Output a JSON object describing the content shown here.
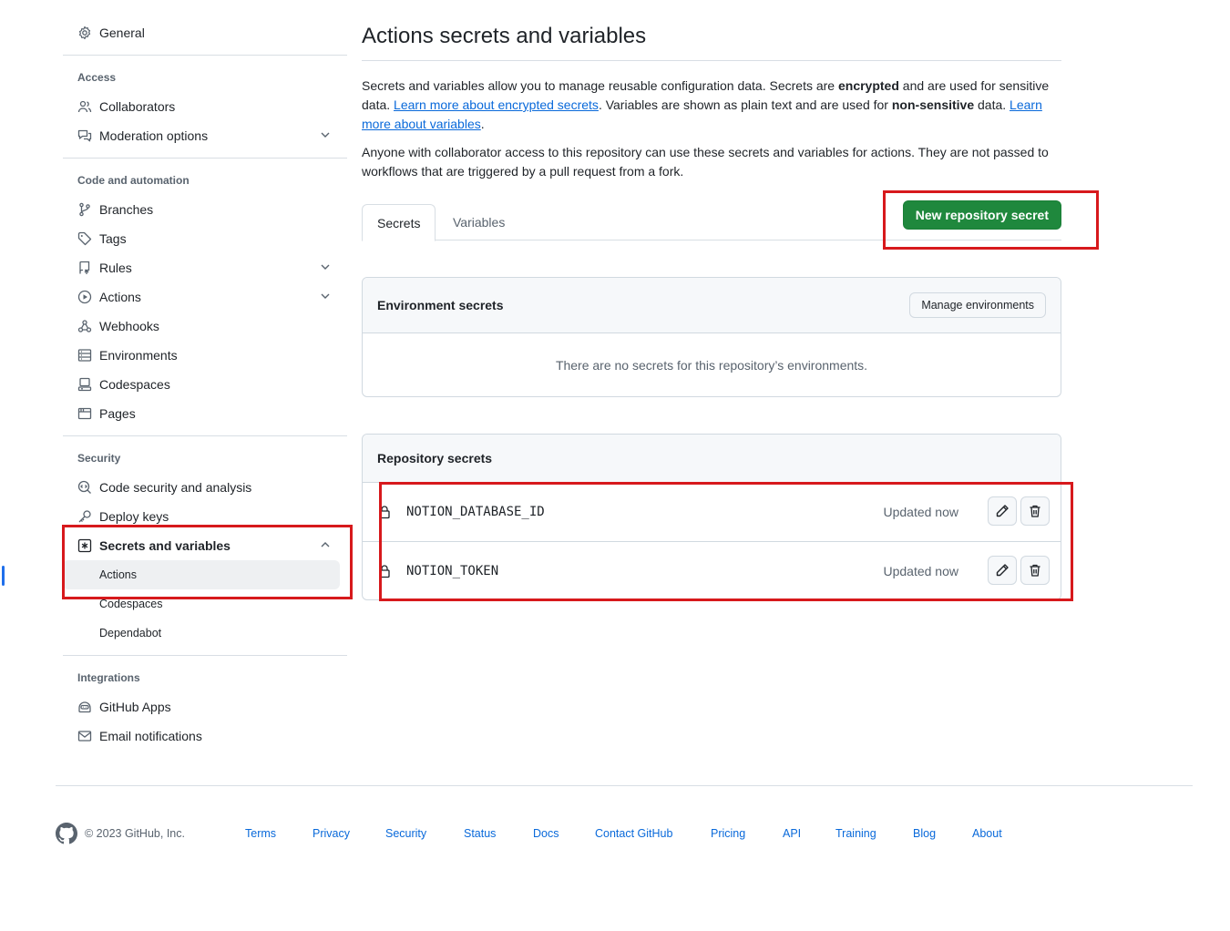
{
  "sidebar": {
    "general": "General",
    "access_header": "Access",
    "collaborators": "Collaborators",
    "moderation": "Moderation options",
    "code_header": "Code and automation",
    "branches": "Branches",
    "tags": "Tags",
    "rules": "Rules",
    "actions": "Actions",
    "webhooks": "Webhooks",
    "environments": "Environments",
    "codespaces": "Codespaces",
    "pages": "Pages",
    "security_header": "Security",
    "code_security": "Code security and analysis",
    "deploy_keys": "Deploy keys",
    "secrets_vars": "Secrets and variables",
    "sub_actions": "Actions",
    "sub_codespaces": "Codespaces",
    "sub_dependabot": "Dependabot",
    "integrations_header": "Integrations",
    "github_apps": "GitHub Apps",
    "email_notifications": "Email notifications"
  },
  "main": {
    "title": "Actions secrets and variables",
    "p1_a": "Secrets and variables allow you to manage reusable configuration data. Secrets are ",
    "p1_b": "encrypted",
    "p1_c": " and are used for sensitive data. ",
    "p1_link1": "Learn more about encrypted secrets",
    "p1_d": ". Variables are shown as plain text and are used for ",
    "p1_e": "non-sensitive",
    "p1_f": " data. ",
    "p1_link2": "Learn more about variables",
    "p1_g": ".",
    "p2": "Anyone with collaborator access to this repository can use these secrets and variables for actions. They are not passed to workflows that are triggered by a pull request from a fork.",
    "tab_secrets": "Secrets",
    "tab_variables": "Variables",
    "new_secret_btn": "New repository secret",
    "env_header": "Environment secrets",
    "manage_env_btn": "Manage environments",
    "env_empty": "There are no secrets for this repository’s environments.",
    "repo_header": "Repository secrets",
    "secrets": [
      {
        "name": "NOTION_DATABASE_ID",
        "updated": "Updated now"
      },
      {
        "name": "NOTION_TOKEN",
        "updated": "Updated now"
      }
    ]
  },
  "footer": {
    "copyright": "© 2023 GitHub, Inc.",
    "links": [
      "Terms",
      "Privacy",
      "Security",
      "Status",
      "Docs",
      "Contact GitHub",
      "Pricing",
      "API",
      "Training",
      "Blog",
      "About"
    ]
  },
  "colors": {
    "primary_green": "#1f883d",
    "link_blue": "#0969da",
    "highlight_red": "#d7191c"
  }
}
